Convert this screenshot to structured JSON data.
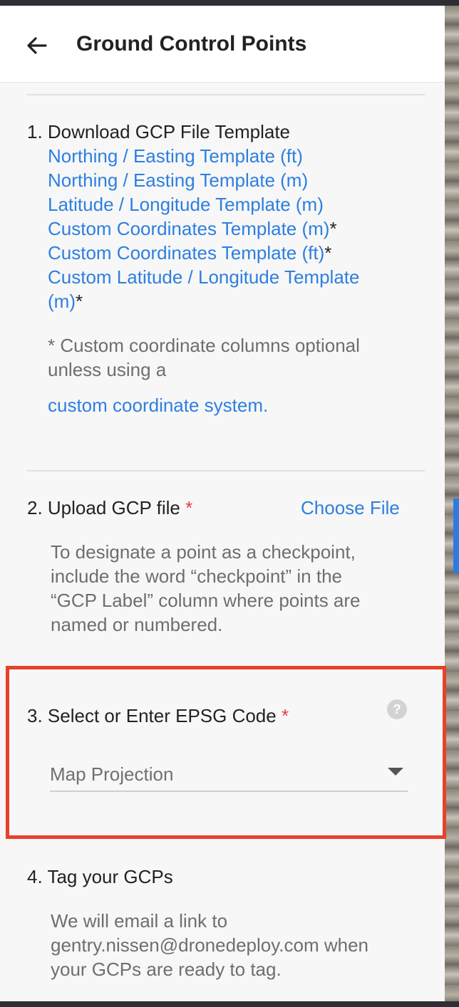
{
  "header": {
    "title": "Ground Control Points",
    "back_icon": "arrow-left-icon"
  },
  "step1": {
    "label": "1. Download GCP File Template",
    "templates": [
      {
        "text": "Northing / Easting Template (ft)",
        "asterisk": ""
      },
      {
        "text": "Northing / Easting Template (m)",
        "asterisk": ""
      },
      {
        "text": "Latitude / Longitude Template (m)",
        "asterisk": ""
      },
      {
        "text": "Custom Coordinates Template (m)",
        "asterisk": "*"
      },
      {
        "text": "Custom Coordinates Template (ft)",
        "asterisk": "*"
      },
      {
        "text": "Custom Latitude / Longitude Template",
        "asterisk": ""
      },
      {
        "text": "(m)",
        "asterisk": "*"
      }
    ],
    "note_line1": "* Custom coordinate columns optional",
    "note_line2": "unless using a",
    "custom_link": "custom coordinate system."
  },
  "step2": {
    "label": "2. Upload GCP file",
    "required_mark": "*",
    "choose_file": "Choose File",
    "note_lines": [
      "To designate a point as a checkpoint,",
      "include the word “checkpoint” in the",
      "“GCP Label” column where points are",
      "named or numbered."
    ]
  },
  "step3": {
    "label": "3. Select or Enter EPSG Code",
    "required_mark": "*",
    "help_icon": "?",
    "placeholder": "Map Projection",
    "highlight_color": "#e8412a"
  },
  "step4": {
    "label": "4. Tag your GCPs",
    "note_lines": [
      "We will email a link to",
      "gentry.nissen@dronedeploy.com when",
      "your GCPs are ready to tag."
    ]
  },
  "colors": {
    "link": "#2d7fe0",
    "required": "#e53950",
    "text": "#222222",
    "muted": "#6e6e6e"
  }
}
